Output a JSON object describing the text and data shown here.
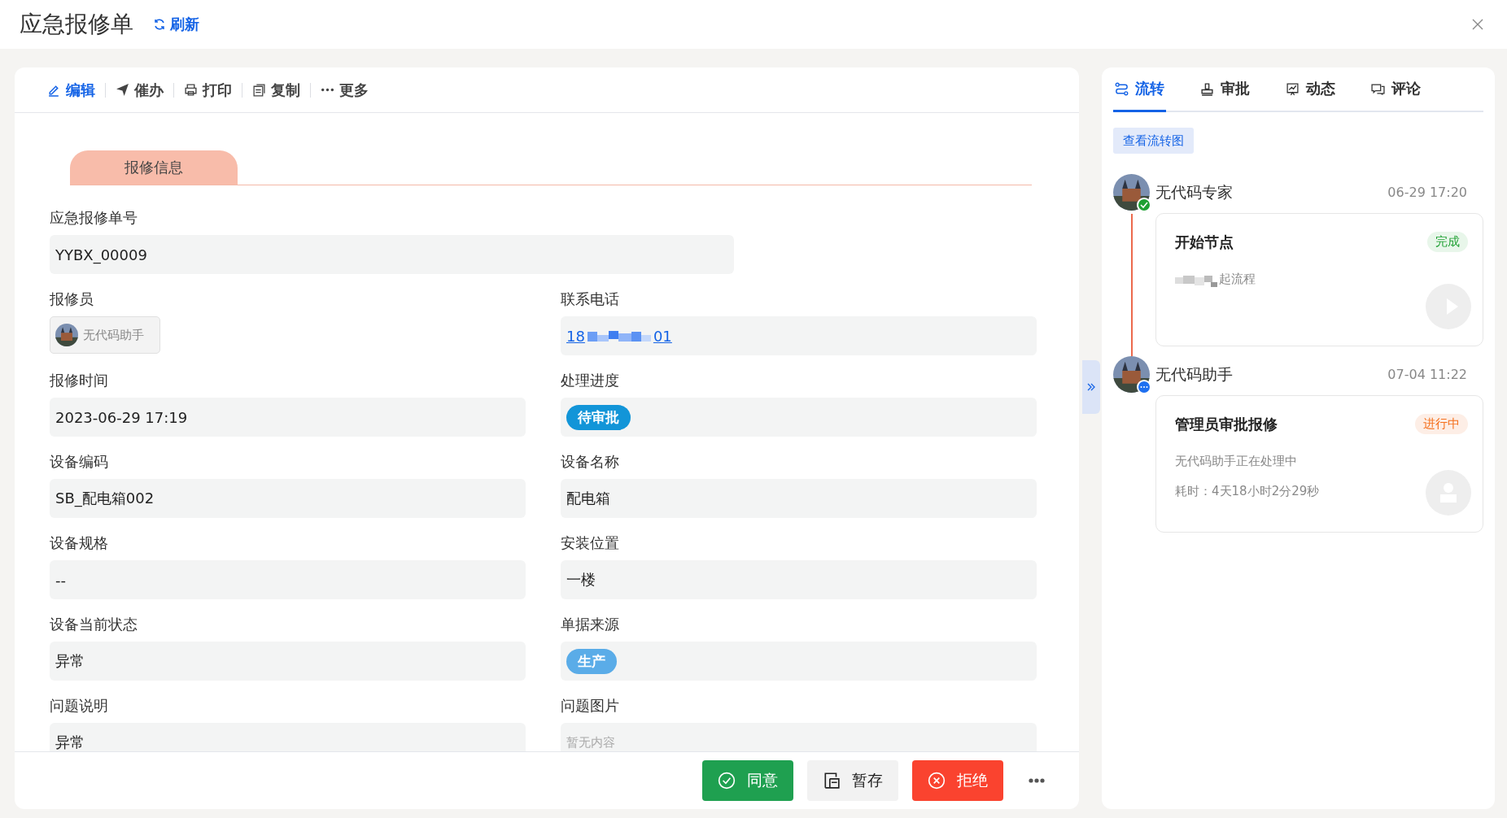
{
  "header": {
    "title": "应急报修单",
    "refresh": "刷新"
  },
  "toolbar": [
    {
      "label": "编辑",
      "kind": "edit",
      "primary": true
    },
    {
      "label": "催办",
      "kind": "send",
      "primary": false
    },
    {
      "label": "打印",
      "kind": "print",
      "primary": false
    },
    {
      "label": "复制",
      "kind": "copy",
      "primary": false
    },
    {
      "label": "更多",
      "kind": "more",
      "primary": false
    }
  ],
  "section": "报修信息",
  "fields": [
    {
      "label": "应急报修单号",
      "kind": "text",
      "value": "YYBX_00009",
      "wide": true
    },
    {
      "label": "报修员",
      "kind": "user",
      "value": "无代码助手"
    },
    {
      "label": "联系电话",
      "kind": "phone",
      "head": "18",
      "tail": "01"
    },
    {
      "label": "报修时间",
      "kind": "text",
      "value": "2023-06-29 17:19"
    },
    {
      "label": "处理进度",
      "kind": "tag",
      "value": "待审批",
      "color": "#1295d8"
    },
    {
      "label": "设备编码",
      "kind": "text",
      "value": "SB_配电箱002"
    },
    {
      "label": "设备名称",
      "kind": "text",
      "value": "配电箱"
    },
    {
      "label": "设备规格",
      "kind": "text",
      "value": "--"
    },
    {
      "label": "安装位置",
      "kind": "text",
      "value": "一楼"
    },
    {
      "label": "设备当前状态",
      "kind": "text",
      "value": "异常"
    },
    {
      "label": "单据来源",
      "kind": "tag",
      "value": "生产",
      "color": "#5aace8"
    },
    {
      "label": "问题说明",
      "kind": "text",
      "value": "异常"
    },
    {
      "label": "问题图片",
      "kind": "empty",
      "value": "暂无内容"
    }
  ],
  "footer": [
    {
      "label": "同意",
      "kind": "approve"
    },
    {
      "label": "暂存",
      "kind": "save"
    },
    {
      "label": "拒绝",
      "kind": "reject"
    },
    {
      "kind": "more"
    }
  ],
  "tabs": [
    {
      "label": "流转",
      "kind": "flow",
      "selected": true
    },
    {
      "label": "审批",
      "kind": "approve",
      "selected": false
    },
    {
      "label": "动态",
      "kind": "activity",
      "selected": false
    },
    {
      "label": "评论",
      "kind": "comment",
      "selected": false
    }
  ],
  "flow_button": "查看流转图",
  "timeline": [
    {
      "name": "无代码专家",
      "time": "06-29 17:20",
      "kind": "done",
      "node": "开始节点",
      "badge": "完成",
      "lines": [
        {
          "kind": "blurred",
          "text": "起流程"
        }
      ]
    },
    {
      "name": "无代码助手",
      "time": "07-04 11:22",
      "kind": "pending",
      "node": "管理员审批报修",
      "badge": "进行中",
      "lines": [
        {
          "kind": "plain",
          "text": "无代码助手正在处理中"
        },
        {
          "kind": "plain",
          "text": "耗时：4天18小时2分29秒"
        }
      ]
    }
  ]
}
